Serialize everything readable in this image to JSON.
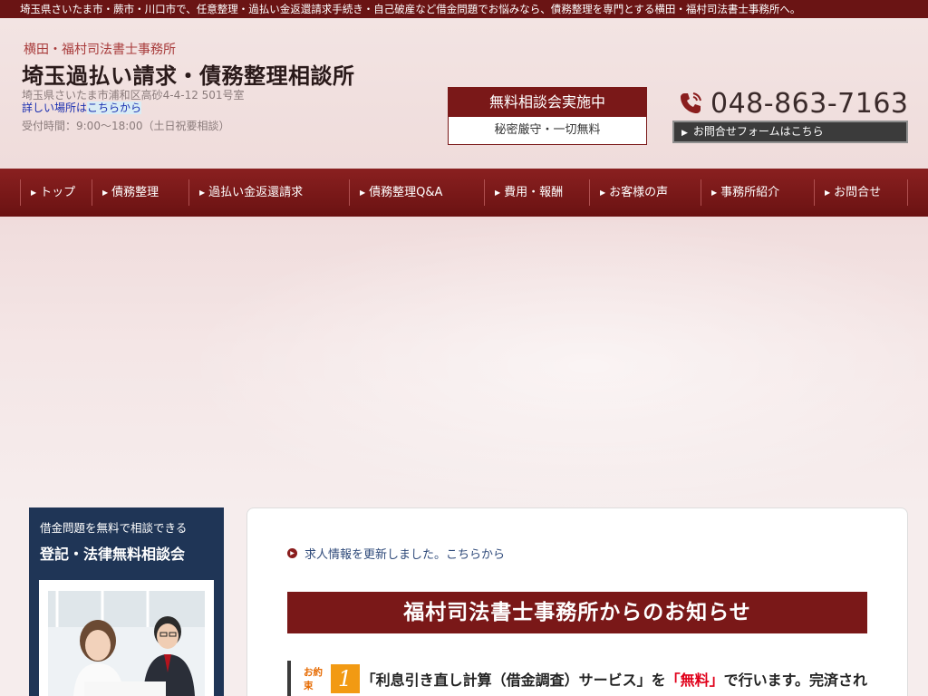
{
  "topbar": {
    "text": "埼玉県さいたま市・蕨市・川口市で、任意整理・過払い金返還請求手続き・自己破産など借金問題でお悩みなら、債務整理を専門とする横田・福村司法書士事務所へ。"
  },
  "header": {
    "office_name": "横田・福村司法書士事務所",
    "site_title": "埼玉過払い請求・債務整理相談所",
    "address": "埼玉県さいたま市浦和区高砂4-4-12 501号室",
    "location_prefix": "詳しい場所は",
    "location_link": "こちらから",
    "hours": "受付時間：9:00〜18:00（土日祝要相談）",
    "consult_title": "無料相談会実施中",
    "consult_sub": "秘密厳守・一切無料",
    "phone": "048-863-7163",
    "form_button": "お問合せフォームはこちら"
  },
  "nav": {
    "items": [
      {
        "label": "トップ"
      },
      {
        "label": "債務整理"
      },
      {
        "label": "過払い金返還請求"
      },
      {
        "label": "債務整理Q&A"
      },
      {
        "label": "費用・報酬"
      },
      {
        "label": "お客様の声"
      },
      {
        "label": "事務所紹介"
      },
      {
        "label": "お問合せ"
      }
    ]
  },
  "side": {
    "sub": "借金問題を無料で相談できる",
    "title": "登記・法律無料相談会"
  },
  "content": {
    "news": "求人情報を更新しました。こちらから",
    "notice_title": "福村司法書士事務所からのお知らせ",
    "promise_label": "お約束",
    "promise_num": "1",
    "promise_text_a": "「利息引き直し計算（借金調査）サービス」を",
    "promise_text_red": "「無料」",
    "promise_text_b": "で行います。完済され"
  },
  "colors": {
    "brand": "#7a1818",
    "side_navy": "#1f3556",
    "accent_orange": "#f29a13",
    "highlight_red": "#e0001a"
  }
}
